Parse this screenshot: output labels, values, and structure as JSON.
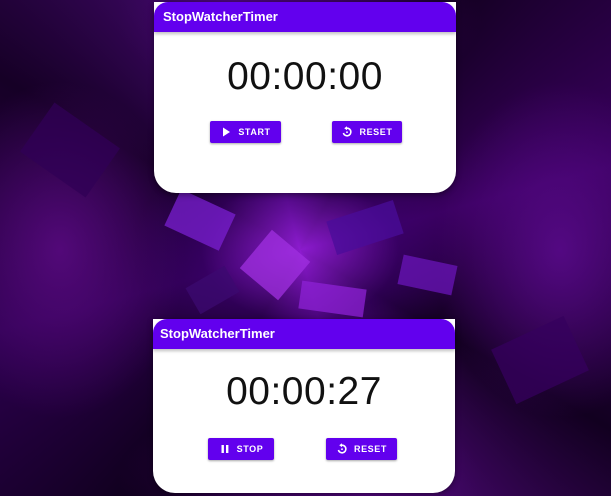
{
  "colors": {
    "primary": "#6200ee",
    "surface": "#ffffff",
    "text": "#111111"
  },
  "cards": [
    {
      "title": "StopWatcherTimer",
      "time": "00:00:00",
      "primary_button": {
        "label": "START",
        "icon": "play-icon"
      },
      "reset_button": {
        "label": "RESET",
        "icon": "reset-icon"
      }
    },
    {
      "title": "StopWatcherTimer",
      "time": "00:00:27",
      "primary_button": {
        "label": "STOP",
        "icon": "pause-icon"
      },
      "reset_button": {
        "label": "RESET",
        "icon": "reset-icon"
      }
    }
  ]
}
